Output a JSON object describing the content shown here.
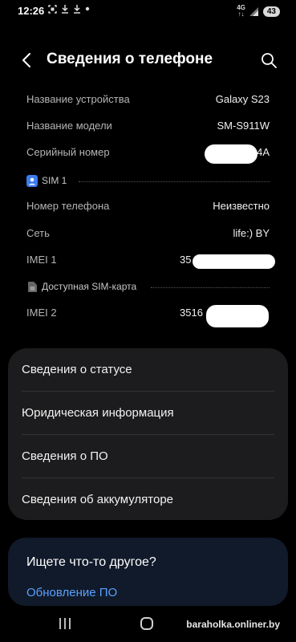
{
  "status_bar": {
    "time": "12:26",
    "network": "4G",
    "battery": "43",
    "icons": [
      "screenshot-icon",
      "download-icon",
      "download-icon",
      "dot-icon",
      "signal-icon"
    ]
  },
  "header": {
    "title": "Сведения о телефоне",
    "back_icon": "back-arrow-icon",
    "search_icon": "search-icon"
  },
  "info_rows": [
    {
      "label": "Название устройства",
      "value": "Galaxy S23"
    },
    {
      "label": "Название модели",
      "value": "SM-S911W"
    },
    {
      "label": "Серийный номер",
      "value": "R          4A"
    }
  ],
  "sim1": {
    "label": "SIM 1",
    "rows": [
      {
        "label": "Номер телефона",
        "value": "Неизвестно"
      },
      {
        "label": "Сеть",
        "value": "life:) BY"
      },
      {
        "label": "IMEI 1",
        "value": "35"
      }
    ]
  },
  "sim2": {
    "label": "Доступная SIM-карта",
    "rows": [
      {
        "label": "IMEI 2",
        "value": "3516"
      }
    ]
  },
  "menu": [
    {
      "label": "Сведения о статусе"
    },
    {
      "label": "Юридическая информация"
    },
    {
      "label": "Сведения о ПО"
    },
    {
      "label": "Сведения об аккумуляторе"
    }
  ],
  "suggest": {
    "title": "Ищете что-то другое?",
    "link": "Обновление ПО"
  },
  "watermark": "baraholka.onliner.by",
  "colors": {
    "background": "#000000",
    "card": "#1c1c1e",
    "link": "#5aa0ff",
    "sim_icon": "#3d7bf0"
  }
}
